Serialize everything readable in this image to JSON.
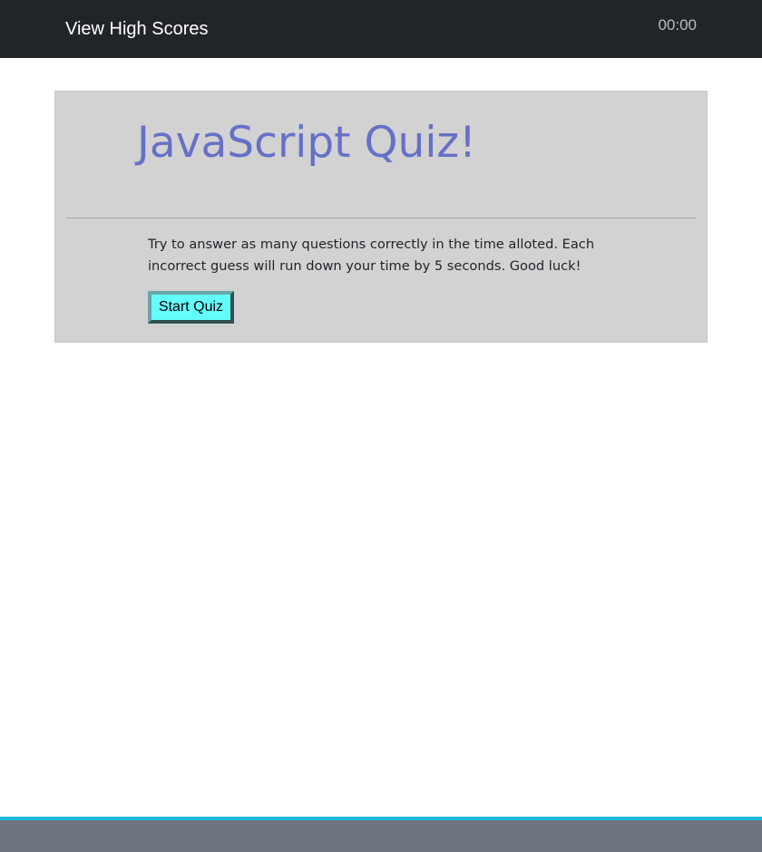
{
  "navbar": {
    "high_scores_label": "View High Scores",
    "timer": "00:00"
  },
  "main": {
    "title": "JavaScript Quiz!",
    "instructions": "Try to answer as many questions correctly in the time alloted. Each incorrect guess will run down your time by 5 seconds. Good luck!",
    "start_button_label": "Start Quiz"
  },
  "colors": {
    "navbar_bg": "#212529",
    "jumbotron_bg": "#d3d2d3",
    "title": "#6571c7",
    "start_button_bg": "#63fdfc",
    "footer_accent": "#1eb7d9",
    "footer_bg": "#6c757d"
  }
}
